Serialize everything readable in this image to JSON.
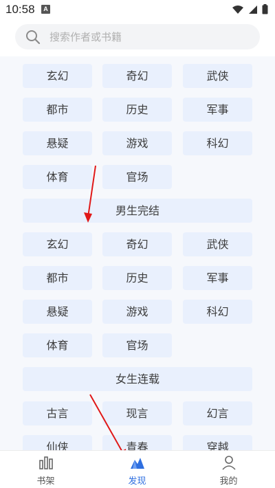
{
  "status_bar": {
    "time": "10:58",
    "badge": "A",
    "icons": [
      "wifi-icon",
      "signal-icon",
      "battery-icon"
    ]
  },
  "search": {
    "placeholder": "搜索作者或书籍"
  },
  "sections": [
    {
      "title": "",
      "categories": [
        "玄幻",
        "奇幻",
        "武侠",
        "都市",
        "历史",
        "军事",
        "悬疑",
        "游戏",
        "科幻",
        "体育",
        "官场"
      ]
    },
    {
      "title": "男生完结",
      "categories": [
        "玄幻",
        "奇幻",
        "武侠",
        "历史",
        "都市",
        "军事",
        "悬疑",
        "游戏",
        "科幻",
        "体育",
        "官场"
      ]
    },
    {
      "title": "女生连载",
      "categories": [
        "古言",
        "现言",
        "幻言",
        "仙侠",
        "青春",
        "穿越"
      ]
    }
  ],
  "bottom_nav": {
    "items": [
      {
        "label": "书架",
        "icon": "bookshelf-icon",
        "active": false
      },
      {
        "label": "发现",
        "icon": "discover-icon",
        "active": true
      },
      {
        "label": "我的",
        "icon": "profile-icon",
        "active": false
      }
    ]
  },
  "colors": {
    "chip_bg": "#e9f0fd",
    "panel_bg": "#f6f8fc",
    "accent": "#2f6fe0",
    "arrow": "#e01818"
  }
}
